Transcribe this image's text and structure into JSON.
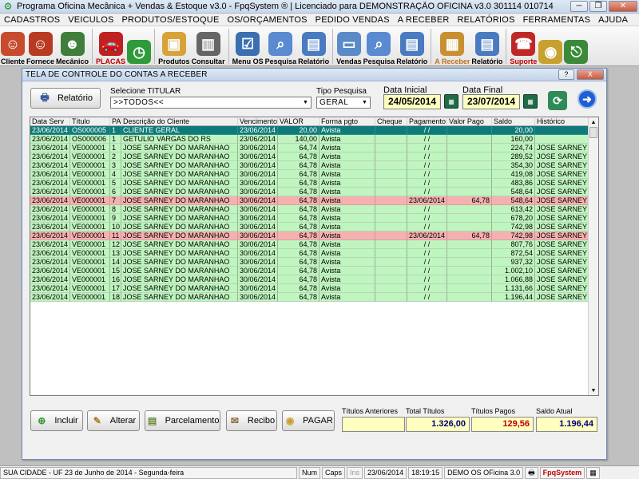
{
  "window": {
    "title": "Programa Oficina Mecânica + Vendas & Estoque v3.0 - FpqSystem ® | Licenciado para  DEMONSTRAÇÃO OFICINA v3.0 301114 010714"
  },
  "menu": [
    "CADASTROS",
    "VEICULOS",
    "PRODUTOS/ESTOQUE",
    "OS/ORÇAMENTOS",
    "PEDIDO VENDAS",
    "A RECEBER",
    "RELATÓRIOS",
    "FERRAMENTAS",
    "AJUDA"
  ],
  "toolbar": [
    {
      "label": "Cliente",
      "icon": "person-icon",
      "color": "#c84b2e"
    },
    {
      "label": "Fornece",
      "icon": "person-icon",
      "color": "#b93a22"
    },
    {
      "label": "Mecânico",
      "icon": "mechanic-icon",
      "color": "#3f7f3a"
    },
    {
      "label": "PLACAS",
      "icon": "car-icon",
      "color": "#c02020"
    },
    {
      "label": "",
      "icon": "clock-icon",
      "color": "#2f9a3a"
    },
    {
      "label": "Produtos",
      "icon": "boxes-icon",
      "color": "#d7a23a"
    },
    {
      "label": "Consultar",
      "icon": "barcode-icon",
      "color": "#666666"
    },
    {
      "label": "Menu OS",
      "icon": "checklist-icon",
      "color": "#3a6fb0"
    },
    {
      "label": "Pesquisa",
      "icon": "search-icon",
      "color": "#5a8ad0"
    },
    {
      "label": "Relatório",
      "icon": "report-icon",
      "color": "#4a7ac0"
    },
    {
      "label": "Vendas",
      "icon": "monitor-icon",
      "color": "#5a8ac8"
    },
    {
      "label": "Pesquisa",
      "icon": "search-icon",
      "color": "#5a8ad0"
    },
    {
      "label": "Relatório",
      "icon": "report-icon",
      "color": "#4a7ac0"
    },
    {
      "label": "A Receber",
      "icon": "calculator-icon",
      "color": "#c89030"
    },
    {
      "label": "Relatório",
      "icon": "report-icon",
      "color": "#4a7ac0"
    },
    {
      "label": "Suporte",
      "icon": "support-icon",
      "color": "#c02828"
    },
    {
      "label": "",
      "icon": "coin-icon",
      "color": "#c8a030"
    },
    {
      "label": "",
      "icon": "exit-icon",
      "color": "#3a8a3a"
    }
  ],
  "dialog": {
    "title": "TELA DE CONTROLE DO CONTAS A RECEBER",
    "help": "?",
    "close": "X",
    "relatorio_btn": "Relatório",
    "titular_label": "Selecione TITULAR",
    "titular_value": ">>TODOS<<",
    "tipo_label": "Tipo  Pesquisa",
    "tipo_value": "GERAL",
    "data_inicial_label": "Data Inicial",
    "data_inicial": "24/05/2014",
    "data_final_label": "Data Final",
    "data_final": "23/07/2014"
  },
  "grid": {
    "headers": [
      "Data Serv",
      "Título",
      "PA",
      "Descrição do Cliente",
      "Vencimento",
      "VALOR",
      "Forma pgto",
      "Cheque",
      "Pagamento",
      "Valor Pago",
      "Saldo",
      "Histórico"
    ],
    "rows": [
      {
        "style": "sel",
        "cells": [
          "23/06/2014",
          "OS000005",
          "1",
          "CLIENTE GERAL",
          "23/06/2014",
          "20,00",
          "Avista",
          "",
          " / /",
          "",
          "20,00",
          ""
        ]
      },
      {
        "style": "green",
        "cells": [
          "23/06/2014",
          "OS000006",
          "1",
          "GETULIO VARGAS DO RS",
          "23/06/2014",
          "140,00",
          "Avista",
          "",
          " / /",
          "",
          "160,00",
          ""
        ]
      },
      {
        "style": "green",
        "cells": [
          "23/06/2014",
          "VE000001",
          "1",
          "JOSE SARNEY DO MARANHAO",
          "30/06/2014",
          "64,74",
          "Avista",
          "",
          " / /",
          "",
          "224,74",
          "JOSE SARNEY"
        ]
      },
      {
        "style": "green",
        "cells": [
          "23/06/2014",
          "VE000001",
          "2",
          "JOSE SARNEY DO MARANHAO",
          "30/06/2014",
          "64,78",
          "Avista",
          "",
          " / /",
          "",
          "289,52",
          "JOSE SARNEY"
        ]
      },
      {
        "style": "green",
        "cells": [
          "23/06/2014",
          "VE000001",
          "3",
          "JOSE SARNEY DO MARANHAO",
          "30/06/2014",
          "64,78",
          "Avista",
          "",
          " / /",
          "",
          "354,30",
          "JOSE SARNEY"
        ]
      },
      {
        "style": "green",
        "cells": [
          "23/06/2014",
          "VE000001",
          "4",
          "JOSE SARNEY DO MARANHAO",
          "30/06/2014",
          "64,78",
          "Avista",
          "",
          " / /",
          "",
          "419,08",
          "JOSE SARNEY"
        ]
      },
      {
        "style": "green",
        "cells": [
          "23/06/2014",
          "VE000001",
          "5",
          "JOSE SARNEY DO MARANHAO",
          "30/06/2014",
          "64,78",
          "Avista",
          "",
          " / /",
          "",
          "483,86",
          "JOSE SARNEY"
        ]
      },
      {
        "style": "green",
        "cells": [
          "23/06/2014",
          "VE000001",
          "6",
          "JOSE SARNEY DO MARANHAO",
          "30/06/2014",
          "64,78",
          "Avista",
          "",
          " / /",
          "",
          "548,64",
          "JOSE SARNEY"
        ]
      },
      {
        "style": "red",
        "cells": [
          "23/06/2014",
          "VE000001",
          "7",
          "JOSE SARNEY DO MARANHAO",
          "30/06/2014",
          "64,78",
          "Avista",
          "",
          "23/06/2014",
          "64,78",
          "548,64",
          "JOSE SARNEY"
        ]
      },
      {
        "style": "green",
        "cells": [
          "23/06/2014",
          "VE000001",
          "8",
          "JOSE SARNEY DO MARANHAO",
          "30/06/2014",
          "64,78",
          "Avista",
          "",
          " / /",
          "",
          "613,42",
          "JOSE SARNEY"
        ]
      },
      {
        "style": "green",
        "cells": [
          "23/06/2014",
          "VE000001",
          "9",
          "JOSE SARNEY DO MARANHAO",
          "30/06/2014",
          "64,78",
          "Avista",
          "",
          " / /",
          "",
          "678,20",
          "JOSE SARNEY"
        ]
      },
      {
        "style": "green",
        "cells": [
          "23/06/2014",
          "VE000001",
          "10",
          "JOSE SARNEY DO MARANHAO",
          "30/06/2014",
          "64,78",
          "Avista",
          "",
          " / /",
          "",
          "742,98",
          "JOSE SARNEY"
        ]
      },
      {
        "style": "red",
        "cells": [
          "23/06/2014",
          "VE000001",
          "11",
          "JOSE SARNEY DO MARANHAO",
          "30/06/2014",
          "64,78",
          "Avista",
          "",
          "23/06/2014",
          "64,78",
          "742,98",
          "JOSE SARNEY"
        ]
      },
      {
        "style": "green",
        "cells": [
          "23/06/2014",
          "VE000001",
          "12",
          "JOSE SARNEY DO MARANHAO",
          "30/06/2014",
          "64,78",
          "Avista",
          "",
          " / /",
          "",
          "807,76",
          "JOSE SARNEY"
        ]
      },
      {
        "style": "green",
        "cells": [
          "23/06/2014",
          "VE000001",
          "13",
          "JOSE SARNEY DO MARANHAO",
          "30/06/2014",
          "64,78",
          "Avista",
          "",
          " / /",
          "",
          "872,54",
          "JOSE SARNEY"
        ]
      },
      {
        "style": "green",
        "cells": [
          "23/06/2014",
          "VE000001",
          "14",
          "JOSE SARNEY DO MARANHAO",
          "30/06/2014",
          "64,78",
          "Avista",
          "",
          " / /",
          "",
          "937,32",
          "JOSE SARNEY"
        ]
      },
      {
        "style": "green",
        "cells": [
          "23/06/2014",
          "VE000001",
          "15",
          "JOSE SARNEY DO MARANHAO",
          "30/06/2014",
          "64,78",
          "Avista",
          "",
          " / /",
          "",
          "1.002,10",
          "JOSE SARNEY"
        ]
      },
      {
        "style": "green",
        "cells": [
          "23/06/2014",
          "VE000001",
          "16",
          "JOSE SARNEY DO MARANHAO",
          "30/06/2014",
          "64,78",
          "Avista",
          "",
          " / /",
          "",
          "1.066,88",
          "JOSE SARNEY"
        ]
      },
      {
        "style": "green",
        "cells": [
          "23/06/2014",
          "VE000001",
          "17",
          "JOSE SARNEY DO MARANHAO",
          "30/06/2014",
          "64,78",
          "Avista",
          "",
          " / /",
          "",
          "1.131,66",
          "JOSE SARNEY"
        ]
      },
      {
        "style": "green",
        "cells": [
          "23/06/2014",
          "VE000001",
          "18",
          "JOSE SARNEY DO MARANHAO",
          "30/06/2014",
          "64,78",
          "Avista",
          "",
          " / /",
          "",
          "1.196,44",
          "JOSE SARNEY"
        ]
      }
    ]
  },
  "actions": {
    "incluir": "Incluir",
    "alterar": "Alterar",
    "parcelamento": "Parcelamento",
    "recibo": "Recibo",
    "pagar": "PAGAR"
  },
  "totals": {
    "anteriores_label": "Títulos Anteriores",
    "anteriores": "",
    "total_label": "Total Títulos",
    "total": "1.326,00",
    "pagos_label": "Títulos Pagos",
    "pagos": "129,56",
    "saldo_label": "Saldo Atual",
    "saldo": "1.196,44",
    "pagos_color": "#c00000",
    "total_color": "#00007a"
  },
  "status": {
    "city": "SUA CIDADE - UF 23 de Junho de 2014 - Segunda-feira",
    "num": "Num",
    "caps": "Caps",
    "ins": "Ins",
    "date": "23/06/2014",
    "time": "18:19:15",
    "version": "DEMO OS OFicina 3.0",
    "brand": "FpqSystem"
  }
}
